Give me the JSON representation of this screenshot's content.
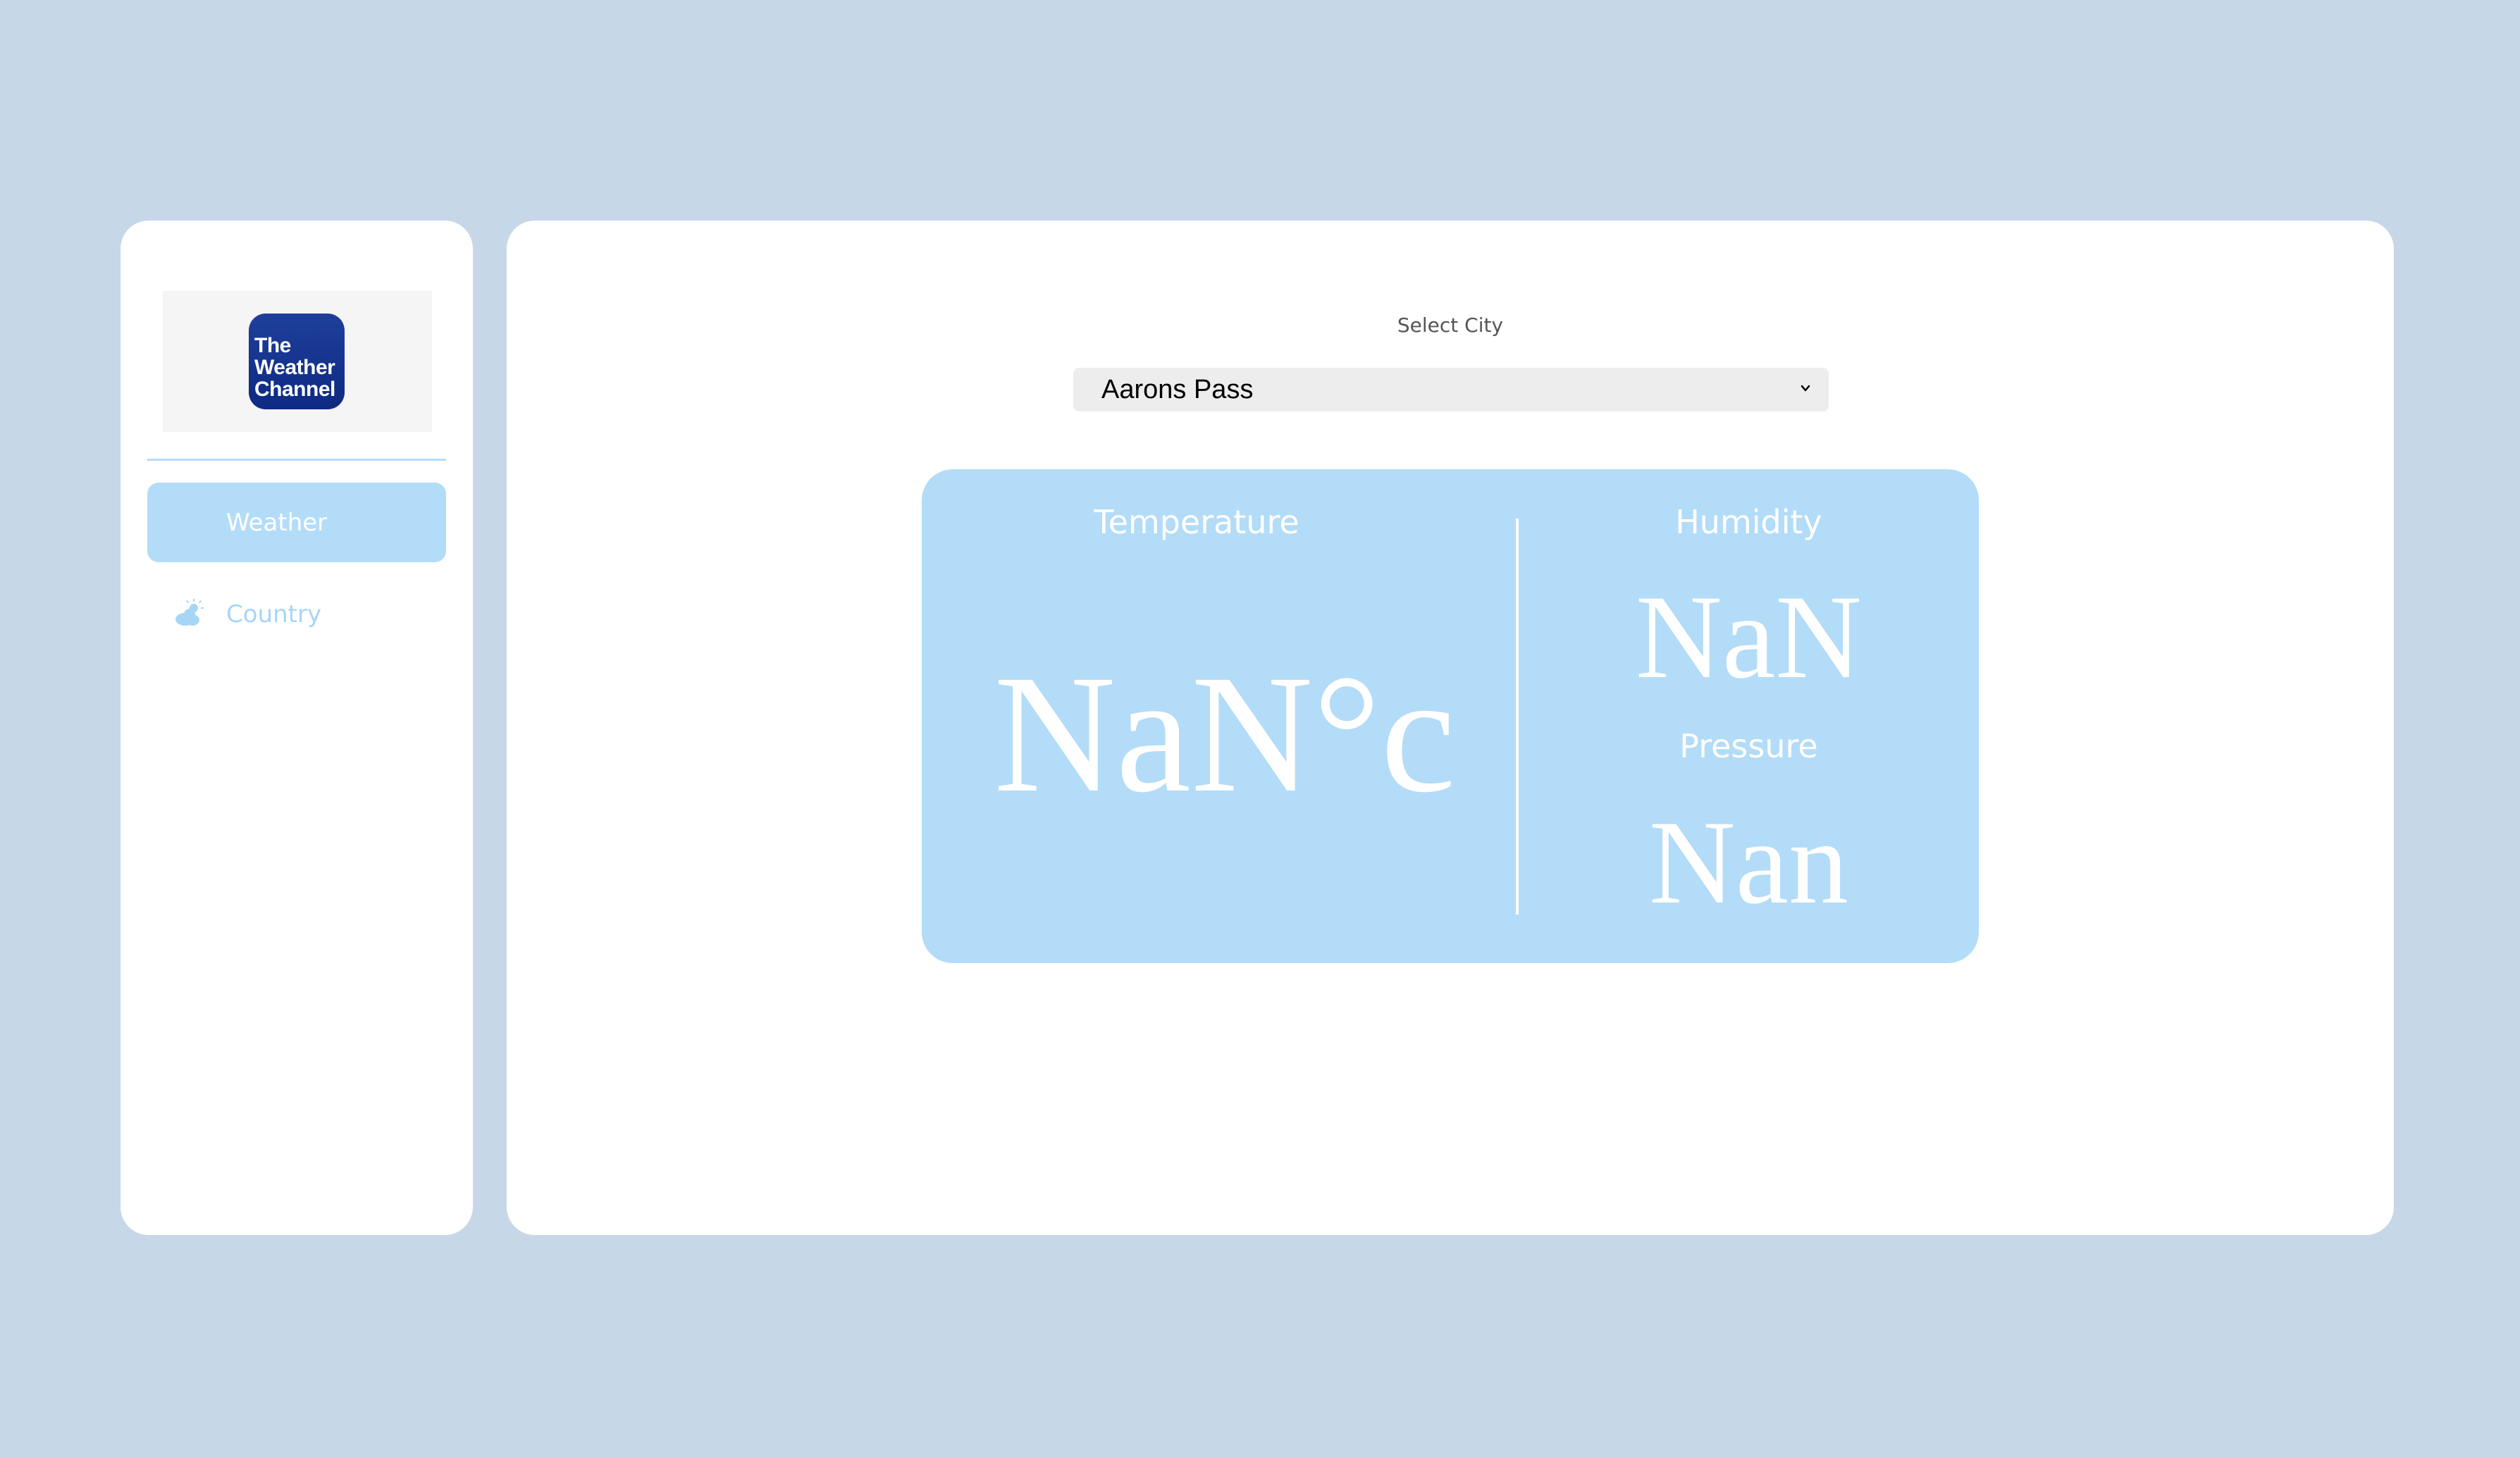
{
  "sidebar": {
    "logo": {
      "line1": "The",
      "line2": "Weather",
      "line3": "Channel"
    },
    "items": [
      {
        "label": "Weather",
        "active": true
      },
      {
        "label": "Country",
        "icon": "partly-cloudy-icon",
        "active": false
      }
    ]
  },
  "main": {
    "select_label": "Select City",
    "city_select": {
      "value": "Aarons Pass",
      "icon": "chevron-down-icon"
    },
    "card": {
      "temperature_label": "Temperature",
      "temperature_value": "NaN°c",
      "humidity_label": "Humidity",
      "humidity_value": "NaN",
      "pressure_label": "Pressure",
      "pressure_value": "Nan"
    }
  },
  "colors": {
    "background": "#c6d7e8",
    "panel": "#ffffff",
    "accent": "#b3dcf8",
    "accent_text": "#a6d6f6",
    "logo_blue": "#1e3f9b"
  }
}
